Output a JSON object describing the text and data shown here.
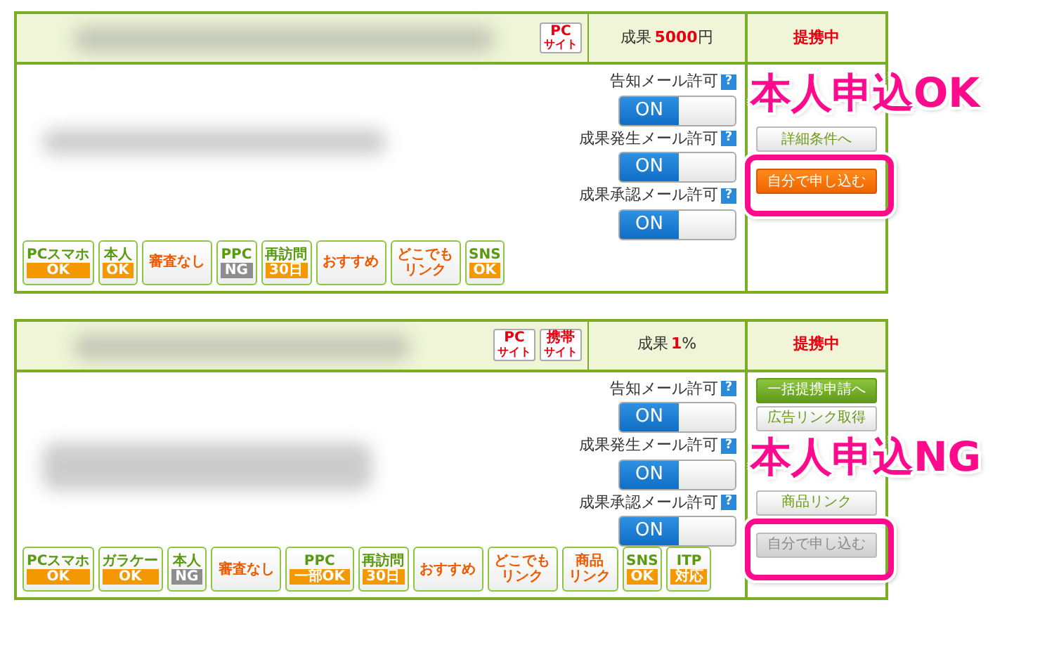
{
  "offers": [
    {
      "site_tags": [
        {
          "top": "PC",
          "bottom": "サイト"
        }
      ],
      "result": {
        "label": "成果",
        "value": "5000",
        "unit": "円"
      },
      "status": "提携中",
      "mail_settings": [
        {
          "label": "告知メール許可",
          "help": "?",
          "toggle": "ON",
          "on": true
        },
        {
          "label": "成果発生メール許可",
          "help": "?",
          "toggle": "ON",
          "on": true
        },
        {
          "label": "成果承認メール許可",
          "help": "?",
          "toggle": "ON",
          "on": true
        }
      ],
      "actions": [
        {
          "kind": "hidden"
        },
        {
          "kind": "hidden"
        },
        {
          "kind": "plain",
          "label": "詳細条件へ"
        },
        {
          "kind": "cut"
        },
        {
          "kind": "orange",
          "label": "自分で申し込む",
          "disabled": false
        }
      ],
      "badges": [
        {
          "kind": "split",
          "top": "PCスマホ",
          "bottom": "OK",
          "ng": false
        },
        {
          "kind": "split",
          "top": "本人",
          "bottom": "OK",
          "ng": false
        },
        {
          "kind": "plain",
          "lines": [
            "審査なし"
          ]
        },
        {
          "kind": "split",
          "top": "PPC",
          "bottom": "NG",
          "ng": true
        },
        {
          "kind": "split",
          "top": "再訪問",
          "bottom": "30日",
          "ng": false
        },
        {
          "kind": "plain",
          "lines": [
            "おすすめ"
          ]
        },
        {
          "kind": "plain",
          "lines": [
            "どこでも",
            "リンク"
          ]
        },
        {
          "kind": "split",
          "top": "SNS",
          "bottom": "OK",
          "ng": false
        }
      ],
      "callout": "本人申込OK"
    },
    {
      "site_tags": [
        {
          "top": "PC",
          "bottom": "サイト"
        },
        {
          "top": "携帯",
          "bottom": "サイト"
        }
      ],
      "result": {
        "label": "成果",
        "value": "1",
        "unit": "%"
      },
      "status": "提携中",
      "mail_settings": [
        {
          "label": "告知メール許可",
          "help": "?",
          "toggle": "ON",
          "on": true
        },
        {
          "label": "成果発生メール許可",
          "help": "?",
          "toggle": "ON",
          "on": true
        },
        {
          "label": "成果承認メール許可",
          "help": "?",
          "toggle": "ON",
          "on": true
        }
      ],
      "actions": [
        {
          "kind": "green",
          "label": "一括提携申請へ"
        },
        {
          "kind": "plain",
          "label": "広告リンク取得"
        },
        {
          "kind": "hidden"
        },
        {
          "kind": "hidden"
        },
        {
          "kind": "plain",
          "label": "商品リンク"
        },
        {
          "kind": "cut"
        },
        {
          "kind": "orange",
          "label": "自分で申し込む",
          "disabled": true
        }
      ],
      "badges": [
        {
          "kind": "split",
          "top": "PCスマホ",
          "bottom": "OK",
          "ng": false
        },
        {
          "kind": "split",
          "top": "ガラケー",
          "bottom": "OK",
          "ng": false
        },
        {
          "kind": "split",
          "top": "本人",
          "bottom": "NG",
          "ng": true
        },
        {
          "kind": "plain",
          "lines": [
            "審査なし"
          ]
        },
        {
          "kind": "split",
          "top": "PPC",
          "bottom": "一部OK",
          "ng": false
        },
        {
          "kind": "split",
          "top": "再訪問",
          "bottom": "30日",
          "ng": false
        },
        {
          "kind": "plain",
          "lines": [
            "おすすめ"
          ]
        },
        {
          "kind": "plain",
          "lines": [
            "どこでも",
            "リンク"
          ]
        },
        {
          "kind": "plain",
          "lines": [
            "商品",
            "リンク"
          ]
        },
        {
          "kind": "split",
          "top": "SNS",
          "bottom": "OK",
          "ng": false
        },
        {
          "kind": "split",
          "top": "ITP",
          "bottom": "対応",
          "ng": false
        }
      ],
      "callout": "本人申込NG"
    }
  ]
}
